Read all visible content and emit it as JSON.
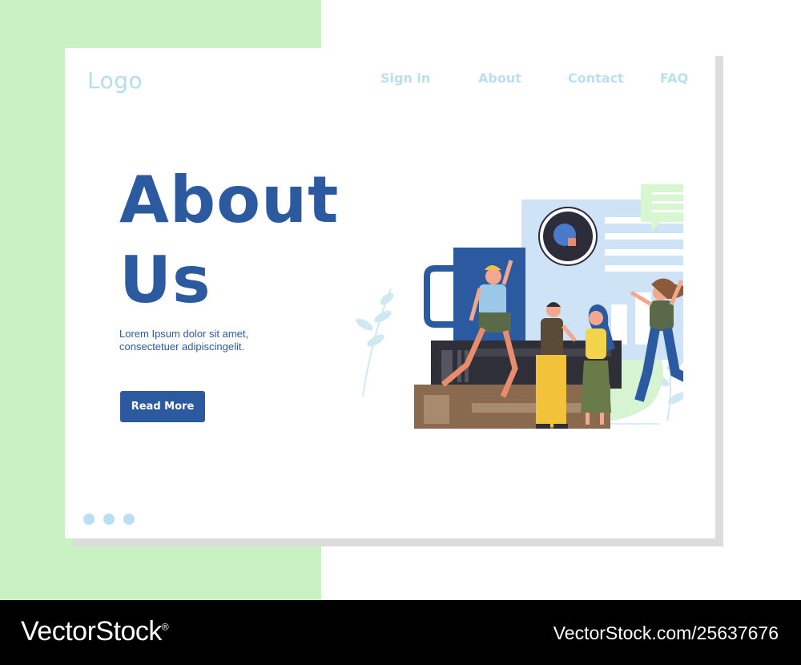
{
  "header": {
    "logo": "Logo",
    "nav": [
      {
        "label": "Sign in"
      },
      {
        "label": "About"
      },
      {
        "label": "Contact"
      },
      {
        "label": "FAQ"
      }
    ]
  },
  "hero": {
    "title_line1": "About",
    "title_line2": "Us",
    "description_line1": "Lorem Ipsum dolor sit amet,",
    "description_line2": "consectetuer adipiscingelit.",
    "button_label": "Read More"
  },
  "carousel": {
    "dot_count": 3
  },
  "footer": {
    "brand": "VectorStock",
    "brand_mark": "®",
    "url": "VectorStock.com/25637676"
  },
  "colors": {
    "primary": "#2c5aa0",
    "nav_text": "#b9e0f2",
    "side_green": "#c9f2c2"
  }
}
